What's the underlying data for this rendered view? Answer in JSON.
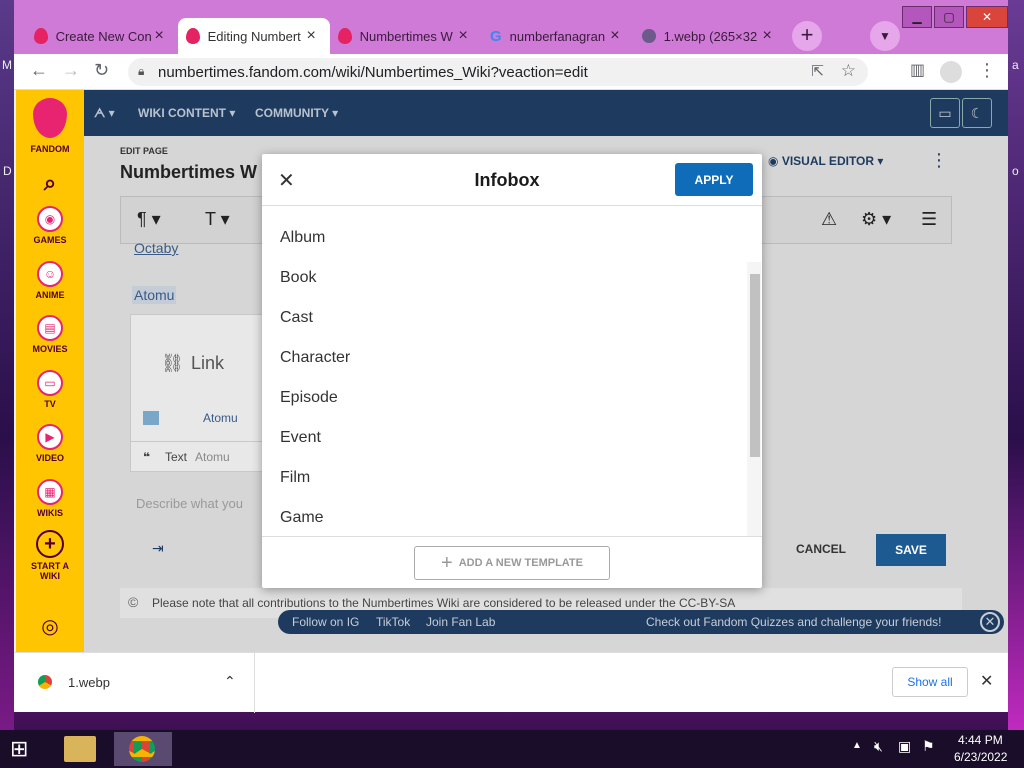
{
  "desktop": {
    "left_letters": [
      "M",
      "D"
    ],
    "right_letters": [
      "a",
      "o"
    ]
  },
  "browser": {
    "tabs": [
      {
        "title": "Create New Con",
        "favicon": "fandom-icon"
      },
      {
        "title": "Editing Numbert",
        "favicon": "fandom-icon",
        "active": true
      },
      {
        "title": "Numbertimes W",
        "favicon": "fandom-icon"
      },
      {
        "title": "numberfanagran",
        "favicon": "google-icon"
      },
      {
        "title": "1.webp (265×32",
        "favicon": "globe-icon"
      }
    ],
    "url": "numbertimes.fandom.com/wiki/Numbertimes_Wiki?veaction=edit"
  },
  "fandom": {
    "logo_label": "FANDOM",
    "sidebar": [
      {
        "label": "GAMES",
        "icon": "gamepad-icon"
      },
      {
        "label": "ANIME",
        "icon": "anime-icon"
      },
      {
        "label": "MOVIES",
        "icon": "clapper-icon"
      },
      {
        "label": "TV",
        "icon": "tv-icon"
      },
      {
        "label": "VIDEO",
        "icon": "play-icon"
      },
      {
        "label": "WIKIS",
        "icon": "book-icon"
      },
      {
        "label": "START A WIKI",
        "icon": "plus-icon"
      }
    ],
    "nav": {
      "wiki_content": "WIKI CONTENT",
      "community": "COMMUNITY"
    }
  },
  "editor": {
    "edit_page": "EDIT PAGE",
    "page_title": "Numbertimes W",
    "visual_editor": "VISUAL EDITOR",
    "text_octaby": "Octaby",
    "text_atomu": "Atomu",
    "link_label": "Link",
    "link_target": "Atomu",
    "text_label": "Text",
    "text_value": "Atomu",
    "summary_placeholder": "Describe what you",
    "cancel": "CANCEL",
    "save": "SAVE",
    "license_note": "Please note that all contributions to the Numbertimes Wiki are considered to be released under the CC-BY-SA"
  },
  "promo": {
    "follow_ig": "Follow on IG",
    "tiktok": "TikTok",
    "fanlab": "Join Fan Lab",
    "quiz": "Check out Fandom Quizzes and challenge your friends!"
  },
  "modal": {
    "title": "Infobox",
    "apply": "APPLY",
    "items": [
      "Album",
      "Book",
      "Cast",
      "Character",
      "Episode",
      "Event",
      "Film",
      "Game"
    ],
    "add_template": "ADD A NEW TEMPLATE"
  },
  "downloads": {
    "file": "1.webp",
    "show_all": "Show all"
  },
  "taskbar": {
    "time": "4:44 PM",
    "date": "6/23/2022"
  }
}
